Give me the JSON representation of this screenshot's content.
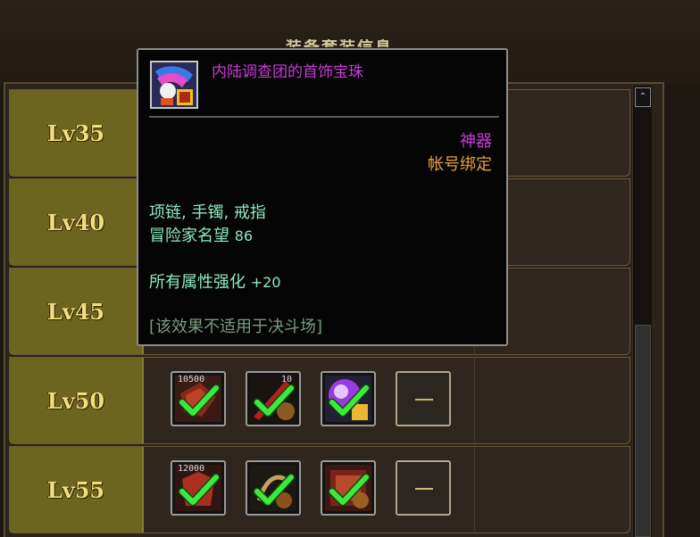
{
  "panel": {
    "title": "装备套装信息"
  },
  "rows": [
    {
      "level": "Lv35"
    },
    {
      "level": "Lv40"
    },
    {
      "level": "Lv45"
    },
    {
      "level": "Lv50",
      "slots": [
        {
          "count": "10500",
          "icon": "weapon-red-icon",
          "checked": true
        },
        {
          "count": "10",
          "icon": "sword-red-icon",
          "checked": true
        },
        {
          "count": "",
          "icon": "orb-purple-icon",
          "checked": true
        },
        {
          "count": "",
          "icon": "empty-slot-icon",
          "checked": false,
          "empty_text": "—"
        }
      ]
    },
    {
      "level": "Lv55",
      "slots": [
        {
          "count": "12000",
          "icon": "armor-red-icon",
          "checked": true
        },
        {
          "count": "",
          "icon": "scroll-icon",
          "checked": true
        },
        {
          "count": "",
          "icon": "gem-red-icon",
          "checked": true
        },
        {
          "count": "",
          "icon": "empty-slot-icon",
          "checked": false,
          "empty_text": "—"
        }
      ]
    }
  ],
  "tooltip": {
    "name": "内陆调查团的首饰宝珠",
    "rarity": "神器",
    "binding": "帐号绑定",
    "equip_types": "项链, 手镯, 戒指",
    "fame_label": "冒险家名望",
    "fame_value": "86",
    "stat_label": "所有属性强化",
    "stat_value": "+20",
    "note": "[该效果不适用于决斗场]",
    "colors": {
      "name": "#c83cd8",
      "binding": "#e8a040",
      "text": "#8ee8c0"
    }
  },
  "scrollbar": {
    "up_icon": "chevron-up-icon",
    "up_glyph": "⌃"
  }
}
